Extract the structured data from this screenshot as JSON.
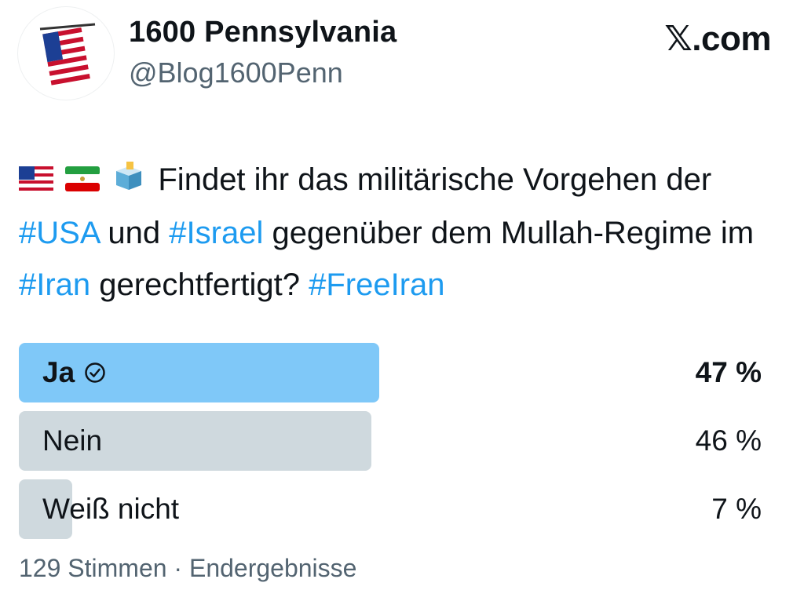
{
  "profile": {
    "display_name": "1600 Pennsylvania",
    "handle": "@Blog1600Penn",
    "avatar_icon": "us-flag-icon"
  },
  "brand": {
    "label": "𝕏.com"
  },
  "tweet": {
    "emojis": [
      "us-flag-icon",
      "iran-flag-icon",
      "ballot-box-icon"
    ],
    "segments": [
      {
        "text": "Findet ihr das militärische Vorgehen der ",
        "type": "text"
      },
      {
        "text": "#USA",
        "type": "hashtag"
      },
      {
        "text": " und ",
        "type": "text"
      },
      {
        "text": "#Israel",
        "type": "hashtag"
      },
      {
        "text": " gegenüber dem Mullah-Regime im ",
        "type": "text"
      },
      {
        "text": "#Iran",
        "type": "hashtag"
      },
      {
        "text": " gerechtfertigt? ",
        "type": "text"
      },
      {
        "text": "#FreeIran",
        "type": "hashtag"
      }
    ]
  },
  "poll": {
    "options": [
      {
        "label": "Ja",
        "percent_label": "47 %",
        "share": 0.47,
        "winner": true
      },
      {
        "label": "Nein",
        "percent_label": "46 %",
        "share": 0.46,
        "winner": false
      },
      {
        "label": "Weiß nicht",
        "percent_label": "7 %",
        "share": 0.07,
        "winner": false
      }
    ],
    "footer": "129 Stimmen · Endergebnisse"
  },
  "colors": {
    "accent": "#1d9bf0",
    "winner_bar": "#7fc8f8",
    "bar": "#cfd9de",
    "muted": "#536471",
    "text": "#0f1419"
  }
}
